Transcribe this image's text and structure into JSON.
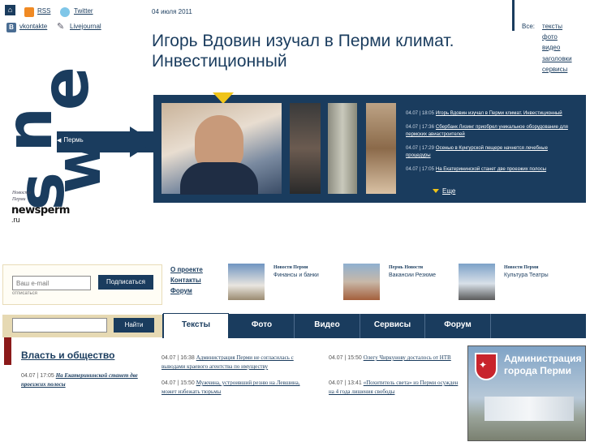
{
  "social": {
    "rss": "RSS",
    "twitter": "Twitter",
    "vkontakte": "vkontakte",
    "livejournal": "Livejournal"
  },
  "date": "04 июля 2011",
  "filters": {
    "label": "Все:",
    "items": [
      "тексты",
      "фото",
      "видео",
      "заголовки",
      "сервисы"
    ]
  },
  "headline": "Игорь Вдовин изучал в Перми климат. Инвестиционный",
  "logo": {
    "city_label": "Пермь",
    "news_small_1": "Новости",
    "news_small_2": "Перми",
    "wordmark": "newsperm",
    "tld": ".ru"
  },
  "news_list": [
    {
      "time": "04.07 | 18:05",
      "text": "Игорь Вдовин изучал в Перми климат. Инвестиционный"
    },
    {
      "time": "04.07 | 17:36",
      "text": "Сбербанк Лизинг приобрел уникальное оборудование для пермских авиастроителей"
    },
    {
      "time": "04.07 | 17:29",
      "text": "Осенью в Кунгурской пещере начнется лечебные процедуры"
    },
    {
      "time": "04.07 | 17:05",
      "text": "На Екатерининской станет две проезжих полосы"
    }
  ],
  "more_label": "Еще",
  "subscribe": {
    "placeholder": "Ваш e-mail",
    "button": "Подписаться",
    "unsubscribe": "отписаться"
  },
  "quicklinks": [
    "О проекте",
    "Контакты",
    "Форум"
  ],
  "promos": [
    {
      "title": "Новости Перми",
      "subtitle": "Финансы и банки"
    },
    {
      "title": "Пермь Новости",
      "subtitle": "Вакансии Резюме"
    },
    {
      "title": "Новости Перми",
      "subtitle": "Культура Театры"
    }
  ],
  "search": {
    "button": "Найти"
  },
  "tabs": [
    "Тексты",
    "Фото",
    "Видео",
    "Сервисы",
    "Форум"
  ],
  "section_title": "Власть и общество",
  "left_news": {
    "time": "04.07 | 17:05",
    "text": "На Екатерининской станет две проезжих полосы"
  },
  "center_news": [
    {
      "time": "04.07 | 16:38",
      "text": "Администрация Перми не согласилась с выводами краевого агентства по имуществу"
    },
    {
      "time": "04.07 | 15:50",
      "text": "Мужчина, устроивший резню на Левшина, может избежать тюрьмы"
    },
    {
      "time": "04.07 | 15:50",
      "text": "Олегу Чиркунову досталось от НТВ"
    },
    {
      "time": "04.07 | 13:41",
      "text": "«Похититель света» из Перми осужден на 4 года лишения свободы"
    }
  ],
  "banner": {
    "line1": "Администрация",
    "line2": "города Перми"
  },
  "colors": {
    "navy": "#1a3c5e",
    "accent": "#f0c419",
    "tan": "#e6d9b3",
    "red": "#8b1a1a"
  }
}
